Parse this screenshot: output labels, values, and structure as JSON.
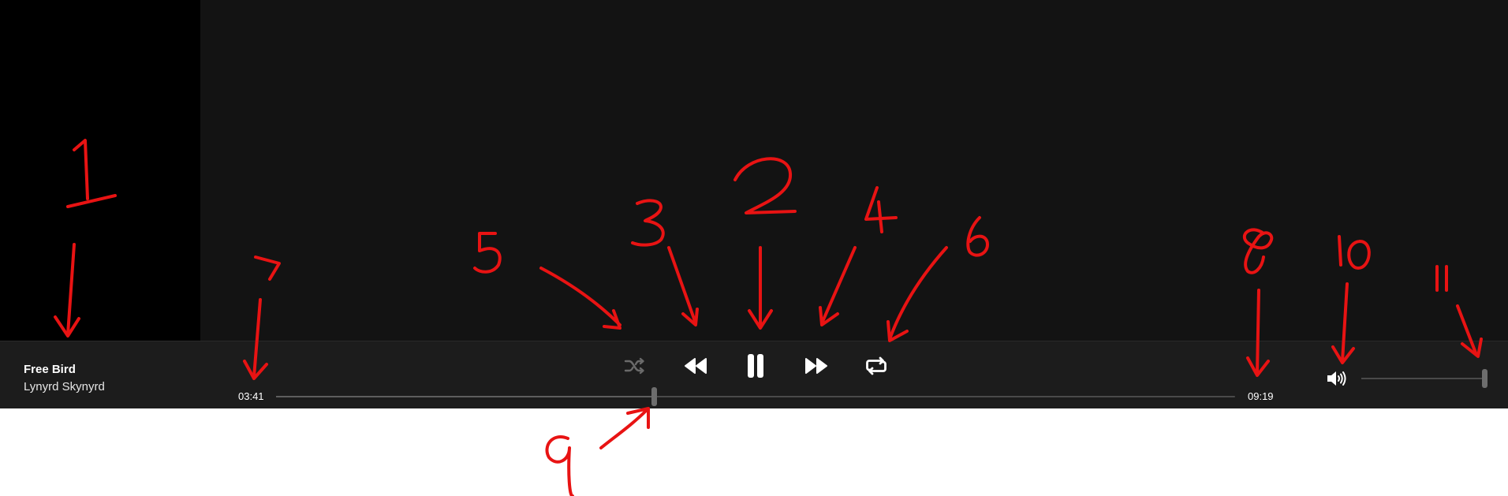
{
  "track": {
    "title": "Free Bird",
    "artist": "Lynyrd Skynyrd"
  },
  "playback": {
    "current_time": "03:41",
    "total_time": "09:19",
    "progress_fraction": 0.394,
    "volume_fraction": 1.0,
    "state": "playing"
  },
  "controls": [
    {
      "name": "shuffle-button",
      "icon": "shuffle-icon",
      "enabled": false
    },
    {
      "name": "previous-button",
      "icon": "rewind-icon",
      "enabled": true
    },
    {
      "name": "pause-button",
      "icon": "pause-icon",
      "enabled": true
    },
    {
      "name": "next-button",
      "icon": "fast-forward-icon",
      "enabled": true
    },
    {
      "name": "repeat-button",
      "icon": "repeat-icon",
      "enabled": true
    }
  ],
  "annotations": [
    "1",
    "2",
    "3",
    "4",
    "5",
    "6",
    "7",
    "8",
    "9",
    "10",
    "11"
  ],
  "colors": {
    "player_bar": "#1c1c1c",
    "app_background": "#131313",
    "sidebar": "#000000",
    "annotation": "#e81313",
    "disabled_icon": "#6a6a6a"
  }
}
